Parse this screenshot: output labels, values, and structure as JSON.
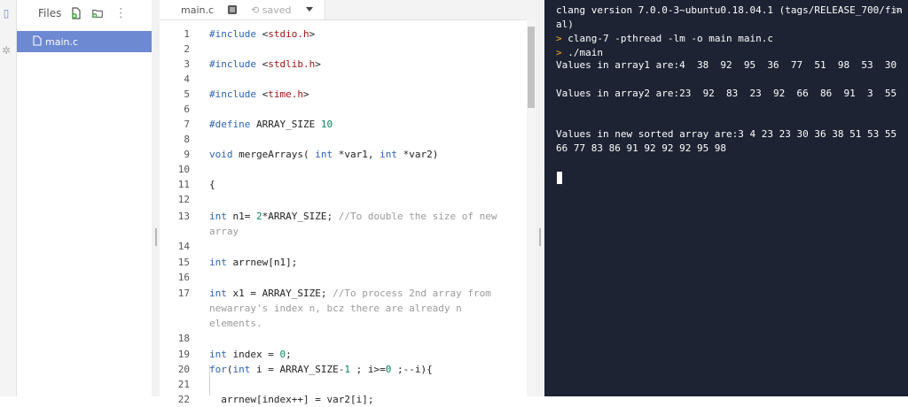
{
  "files_panel": {
    "title": "Files",
    "files": [
      "main.c"
    ]
  },
  "editor": {
    "tab_name": "main.c",
    "save_status": "saved",
    "lines": [
      {
        "n": "1",
        "html": "<span class=\"kw\">#include</span> &lt;<span class=\"inc\">stdio.h</span>&gt;"
      },
      {
        "n": "2",
        "html": ""
      },
      {
        "n": "3",
        "html": "<span class=\"kw\">#include</span> &lt;<span class=\"inc\">stdlib.h</span>&gt;"
      },
      {
        "n": "4",
        "html": ""
      },
      {
        "n": "5",
        "html": "<span class=\"kw\">#include</span> &lt;<span class=\"inc\">time.h</span>&gt;"
      },
      {
        "n": "6",
        "html": ""
      },
      {
        "n": "7",
        "html": "<span class=\"kw\">#define</span> ARRAY_SIZE <span class=\"num\">10</span>"
      },
      {
        "n": "8",
        "html": ""
      },
      {
        "n": "9",
        "html": "<span class=\"kw\">void</span> mergeArrays( <span class=\"kw\">int</span> *var1, <span class=\"kw\">int</span> *var2)"
      },
      {
        "n": "10",
        "html": ""
      },
      {
        "n": "11",
        "html": "{"
      },
      {
        "n": "12",
        "html": ""
      },
      {
        "n": "13",
        "html": "<span class=\"kw\">int</span> n1= <span class=\"num\">2</span>*ARRAY_SIZE; <span class=\"cm\">//To double the size of new array</span>"
      },
      {
        "n": "14",
        "html": ""
      },
      {
        "n": "15",
        "html": "<span class=\"kw\">int</span> arrnew[n1];"
      },
      {
        "n": "16",
        "html": ""
      },
      {
        "n": "17",
        "html": "<span class=\"kw\">int</span> x1 = ARRAY_SIZE; <span class=\"cm\">//To process 2nd array from newarray's index n, bcz there are already n elements.</span>"
      },
      {
        "n": "18",
        "html": ""
      },
      {
        "n": "19",
        "html": "<span class=\"kw\">int</span> index = <span class=\"num\">0</span>;"
      },
      {
        "n": "20",
        "html": "<span class=\"kw\">for</span>(<span class=\"kw\">int</span> i = ARRAY_SIZE-<span class=\"num\">1</span> ; i&gt;=<span class=\"num\">0</span> ;--i){"
      },
      {
        "n": "21",
        "html": ""
      },
      {
        "n": "22",
        "html": "  arrnew[index++] = var2[i];"
      }
    ]
  },
  "console": {
    "lines": [
      {
        "text": "clang version 7.0.0-3~ubuntu0.18.04.1 (tags/RELEASE_700/final)",
        "prompt": false
      },
      {
        "text": "clang-7 -pthread -lm -o main main.c",
        "prompt": true
      },
      {
        "text": "./main",
        "prompt": true
      },
      {
        "text": "Values in array1 are:4  38  92  95  36  77  51  98  53  30",
        "prompt": false
      },
      {
        "text": "Values in array2 are:23  92  83  23  92  66  86  91  3  55",
        "prompt": false
      },
      {
        "text": "Values in new sorted array are:3 4 23 23 30 36 38 51 53 55 66 77 83 86 91 92 92 92 95 98",
        "prompt": false
      }
    ],
    "prompt_symbol": ">"
  },
  "colors": {
    "console_bg": "#1d2333",
    "accent": "#6d89d2",
    "keyword": "#2d62b4",
    "prompt": "#f5a623"
  }
}
